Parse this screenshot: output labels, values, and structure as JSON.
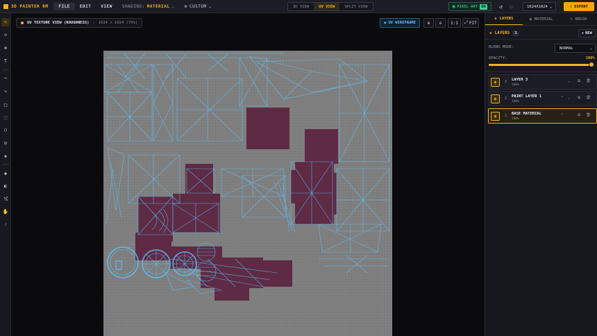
{
  "app": {
    "title": "3D PAINTER RM"
  },
  "menu": {
    "file": "FILE",
    "edit": "EDIT",
    "view": "VIEW"
  },
  "shading": {
    "label": "SHADING:",
    "value": "MATERIAL"
  },
  "custom": {
    "label": "CUSTOM"
  },
  "view_tabs": [
    {
      "label": "3D VIEW"
    },
    {
      "label": "UV VIEW"
    },
    {
      "label": "SPLIT VIEW"
    }
  ],
  "pixel_art": {
    "label": "PIXEL ART",
    "state": "ON"
  },
  "resolution": {
    "value": "1024X1024"
  },
  "export": {
    "label": "EXPORT"
  },
  "viewport": {
    "title": "UV TEXTURE VIEW (ROUGHNESS)",
    "dims": "1024 × 1024 (75%)",
    "wireframe_label": "UV WIREFRAME",
    "zoom_reset": "1:1",
    "fit": "FIT"
  },
  "panel": {
    "tabs": [
      {
        "label": "LAYERS"
      },
      {
        "label": "MATERIAL"
      },
      {
        "label": "BRUSH"
      }
    ],
    "layers_title": "LAYERS",
    "layer_count": "3",
    "new_label": "NEW",
    "blend_label": "BLEND MODE:",
    "blend_value": "NORMAL",
    "opacity_label": "OPACITY:",
    "opacity_value": "100%",
    "opacity_fraction": 1.0
  },
  "layers": [
    {
      "index": "3",
      "name": "LAYER 3",
      "opacity": "100%"
    },
    {
      "index": "2",
      "name": "PAINT LAYER 1",
      "opacity": "100%"
    },
    {
      "index": "1",
      "name": "BASE MATERIAL",
      "opacity": "100%",
      "selected": true
    }
  ],
  "colors": {
    "accent": "#f4b41a",
    "wire": "#5ec3ff",
    "island": "#5e2a44",
    "canvas": "#808080",
    "pixel_art": "#3fd09a"
  },
  "icons": [
    "brush-icon",
    "eraser-icon",
    "fill-icon",
    "text-icon",
    "line-icon",
    "curve-icon",
    "rect-icon",
    "rect-select-icon",
    "circle-icon",
    "circle-select-icon",
    "stamp-icon",
    "bucket-icon",
    "smudge-icon",
    "transform-icon",
    "hand-icon",
    "eyedropper-icon"
  ]
}
